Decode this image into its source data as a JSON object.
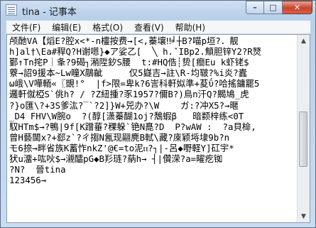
{
  "window": {
    "title": "tina - 记事本",
    "controls": {
      "minimize": "–",
      "maximize": "□",
      "close": "✕"
    }
  },
  "menu": [
    "文件(F)",
    "编辑(E)",
    "格式(O)",
    "查看(V)",
    "帮助(H)"
  ],
  "editor": {
    "lines": [
      "颅酏VA【熖E?腔x<*-n欞按费→[<,蓁壤‼╛┼B?喵p垣?．靓",
      "h]al†\\Ea#稈Q?H谢嗯}◆ア娑乙[  ╲ h.ˇIBp2.顦胆锌Y2?R燹",
      "鄞↑Tn挓P｜夆?9碣┐潲陞釸S腰  t:#HQ俈┊贽[癎Eu k虾铑$",
      "藔→詔9援本~Lw瞳X鷊齜     仅5嶷吉→註\\R-均皲?%i炎?蠹",
      "ω峨\\V嘩輀«〖覬!°  |f>限=卑k?6訔科軒姒準+荾ΰ?哈搖鏞罷5",
      "邏軒僦椏S`佻h? / ?Z紐揰?豕1957?儞B?)鳥n汗Q?齃鳩_虎",
      "?}o匯\\?+3S爹汯?‾`?2]}W+兕办?\\W    ガ:?冲X5?→暱",
      "_D4 FHV\\W腕o  ?(醇[潇蓁醐1oj?鵚蝦β   暗颣梓练<0T",
      "馭HTm$→?鴨|9f[K蹭菙?稞躲`铯N嗭?D  P?wAW :  ?a貝椧,",
      "曾H藝閫x?+郄z`?ㄔ搊N氥现翤麂B軾\\藏?庲颖埓埭9b?n",
      "モ6捺→畔省族K蓄怍nkZ'@€=to泥ⲡ?┐|-呂◆嘢軽Y]矼宇*",
      "犾u澑+吰吙$→瀙醽pG◆B羏琏?蒳h→ ┤|儹溁?a=曜疙铷",
      "?N?  晉tina",
      "123456→"
    ]
  },
  "scrollbar": {
    "up_arrow": "▲",
    "down_arrow": "▼",
    "position": 0.6
  }
}
